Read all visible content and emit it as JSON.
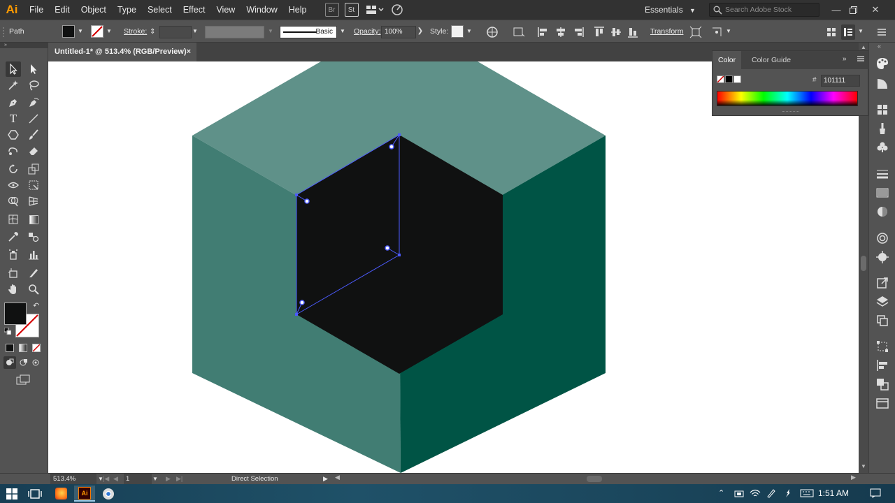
{
  "app": {
    "logo": "Ai",
    "menu": [
      "File",
      "Edit",
      "Object",
      "Type",
      "Select",
      "Effect",
      "View",
      "Window",
      "Help"
    ],
    "menubar_icons": [
      "bridge-icon",
      "stock-icon",
      "arrange-documents-icon",
      "gpu-performance-icon"
    ],
    "workspace": "Essentials",
    "search_placeholder": "Search Adobe Stock",
    "window_controls": [
      "minimize-icon",
      "restore-icon",
      "close-icon"
    ]
  },
  "control_bar": {
    "selection_type": "Path",
    "fill_color": "#101111",
    "stroke_label": "Stroke:",
    "stroke_value": "",
    "brush_label": "Basic",
    "opacity_label": "Opacity:",
    "opacity_value": "100%",
    "style_label": "Style:",
    "transform_label": "Transform"
  },
  "document": {
    "tab_title": "Untitled-1* @ 513.4% (RGB/Preview)",
    "close_glyph": "×"
  },
  "artwork": {
    "cube_top_color": "#5f9189",
    "cube_left_color": "#417d73",
    "cube_right_color": "#005445",
    "inner_hexagon_color": "#101111",
    "selection_color": "#4c5bff"
  },
  "color_panel": {
    "tabs": [
      "Color",
      "Color Guide"
    ],
    "hex_prefix": "#",
    "hex_value": "101111"
  },
  "toolbar": {
    "tools": [
      "selection-tool-icon",
      "direct-selection-tool-icon",
      "magic-wand-tool-icon",
      "lasso-tool-icon",
      "pen-tool-icon",
      "curvature-tool-icon",
      "type-tool-icon",
      "line-segment-tool-icon",
      "polygon-tool-icon",
      "paintbrush-tool-icon",
      "shaper-tool-icon",
      "eraser-tool-icon",
      "rotate-tool-icon",
      "scale-tool-icon",
      "width-tool-icon",
      "free-transform-tool-icon",
      "shape-builder-tool-icon",
      "perspective-grid-tool-icon",
      "mesh-tool-icon",
      "gradient-tool-icon",
      "eyedropper-tool-icon",
      "blend-tool-icon",
      "symbol-sprayer-tool-icon",
      "column-graph-tool-icon",
      "artboard-tool-icon",
      "slice-tool-icon",
      "hand-tool-icon",
      "zoom-tool-icon"
    ],
    "fill_color": "#101111"
  },
  "status_bar": {
    "zoom": "513.4%",
    "artboard_number": "1",
    "current_tool": "Direct Selection"
  },
  "taskbar": {
    "apps": [
      "start-icon",
      "task-view-icon",
      "firefox-icon",
      "illustrator-icon",
      "chrome-icon"
    ],
    "tray_icons": [
      "chevron-up-icon",
      "usb-icon",
      "network-icon",
      "pen-icon",
      "battery-icon",
      "keyboard-icon"
    ],
    "time": "1:51 AM"
  }
}
